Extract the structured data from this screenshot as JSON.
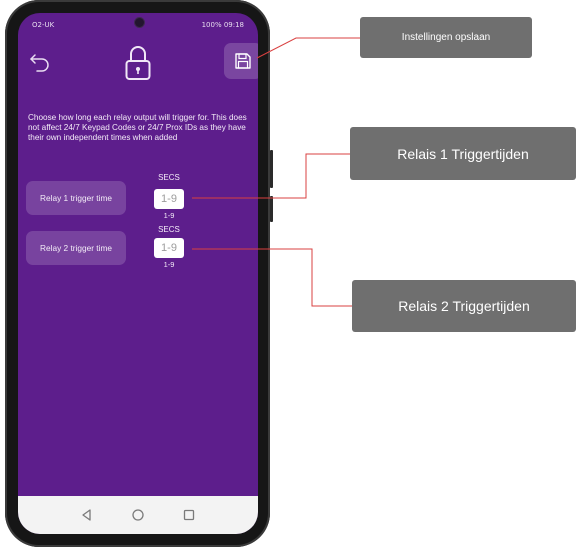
{
  "status_bar": {
    "left": "O2-UK",
    "right": "100% 09:18"
  },
  "description": "Choose how long each relay output will trigger for. This does not affect 24/7 Keypad Codes or 24/7 Prox IDs as they have their own independent times when added",
  "relays": [
    {
      "label": "Relay 1 trigger time",
      "unit": "SECS",
      "placeholder": "1-9",
      "range": "1-9"
    },
    {
      "label": "Relay 2 trigger time",
      "unit": "SECS",
      "placeholder": "1-9",
      "range": "1-9"
    }
  ],
  "callouts": {
    "save_settings": "Instellingen opslaan",
    "relay1_times": "Relais 1 Triggertijden",
    "relay2_times": "Relais 2 Triggertijden"
  },
  "colors": {
    "screen_bg": "#5d1e8c",
    "callout_bg": "#6f6f6f",
    "callout_line": "#d94040"
  },
  "icons": [
    "back-arrow-icon",
    "lock-icon",
    "save-icon",
    "nav-back-icon",
    "nav-home-icon",
    "nav-recents-icon"
  ]
}
